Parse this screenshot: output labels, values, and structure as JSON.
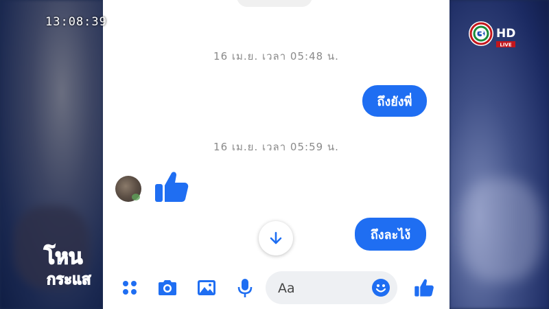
{
  "broadcast": {
    "clock": "13:08:39",
    "channel_logo_text": "3",
    "channel_hd": "HD",
    "channel_live": "LIVE",
    "show_logo_line1": "โหน",
    "show_logo_line2": "กระแส"
  },
  "chat": {
    "messages": [
      {
        "type": "timestamp",
        "text": "16 เม.ย. เวลา 05:48 น."
      },
      {
        "type": "outgoing",
        "text": "ถึงยังพี่"
      },
      {
        "type": "timestamp",
        "text": "16 เม.ย. เวลา 05:59 น."
      },
      {
        "type": "incoming-like",
        "icon": "thumbs-up-icon"
      },
      {
        "type": "outgoing",
        "text": "ถึงละไง้"
      }
    ]
  },
  "composer": {
    "placeholder": "Aa",
    "icons": [
      "apps-icon",
      "camera-icon",
      "gallery-icon",
      "mic-icon",
      "emoji-icon",
      "like-icon"
    ]
  },
  "colors": {
    "messenger_blue": "#1f6ef2",
    "bubble_text": "#ffffff",
    "timestamp_gray": "#8a8a8a"
  }
}
